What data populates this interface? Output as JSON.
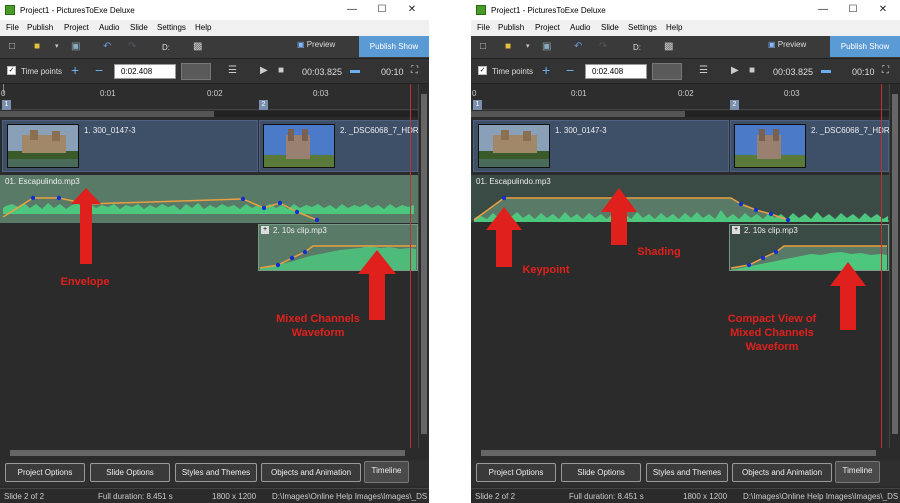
{
  "windows": [
    {
      "title": "Project1 - PicturesToExe Deluxe",
      "menu": [
        "File",
        "Publish",
        "Project",
        "Audio",
        "Slide",
        "Settings",
        "Help"
      ],
      "toolbar": {
        "drive": "D:",
        "preview": "Preview",
        "publish": "Publish Show"
      },
      "toolbar2": {
        "time_points": "Time points",
        "time_value": "0:02.408",
        "cur_time": "00:03.825",
        "end_time": "00:10"
      },
      "ruler": [
        "0",
        "0:01",
        "0:02",
        "0:03"
      ],
      "slides": [
        {
          "num": "1",
          "label": "1. 300_0147-3"
        },
        {
          "num": "2",
          "label": "2. _DSC6068_7_HDR"
        }
      ],
      "audio_track": "01. Escapulindo.mp3",
      "clip": {
        "plus": "+",
        "label": "2. 10s clip.mp3"
      },
      "tabs": [
        "Project Options",
        "Slide Options",
        "Styles and Themes",
        "Objects and Animation",
        "Timeline"
      ],
      "status": {
        "slide": "Slide 2 of 2",
        "duration": "Full duration: 8.451 s",
        "size": "1800 x 1200",
        "path": "D:\\Images\\Online Help Images\\Images\\_DS"
      },
      "annotations": [
        "Envelope",
        "Mixed Channels\nWaveform"
      ]
    },
    {
      "title": "Project1 - PicturesToExe Deluxe",
      "menu": [
        "File",
        "Publish",
        "Project",
        "Audio",
        "Slide",
        "Settings",
        "Help"
      ],
      "toolbar": {
        "drive": "D:",
        "preview": "Preview",
        "publish": "Publish Show"
      },
      "toolbar2": {
        "time_points": "Time points",
        "time_value": "0:02.408",
        "cur_time": "00:03.825",
        "end_time": "00:10"
      },
      "ruler": [
        "0",
        "0:01",
        "0:02",
        "0:03"
      ],
      "slides": [
        {
          "num": "1",
          "label": "1. 300_0147-3"
        },
        {
          "num": "2",
          "label": "2. _DSC6068_7_HDR"
        }
      ],
      "audio_track": "01. Escapulindo.mp3",
      "clip": {
        "plus": "+",
        "label": "2. 10s clip.mp3"
      },
      "tabs": [
        "Project Options",
        "Slide Options",
        "Styles and Themes",
        "Objects and Animation",
        "Timeline"
      ],
      "status": {
        "slide": "Slide 2 of 2",
        "duration": "Full duration: 8.451 s",
        "size": "1800 x 1200",
        "path": "D:\\Images\\Online Help Images\\Images\\_DS"
      },
      "annotations": [
        "Keypoint",
        "Shading",
        "Compact View of\nMixed Channels\nWaveform"
      ]
    }
  ],
  "colors": {
    "accent": "#5b9bd5",
    "annotation": "#e0201c",
    "waveform": "#4ec77e",
    "envelope": "#e8a040",
    "keypoint": "#1030d0"
  }
}
